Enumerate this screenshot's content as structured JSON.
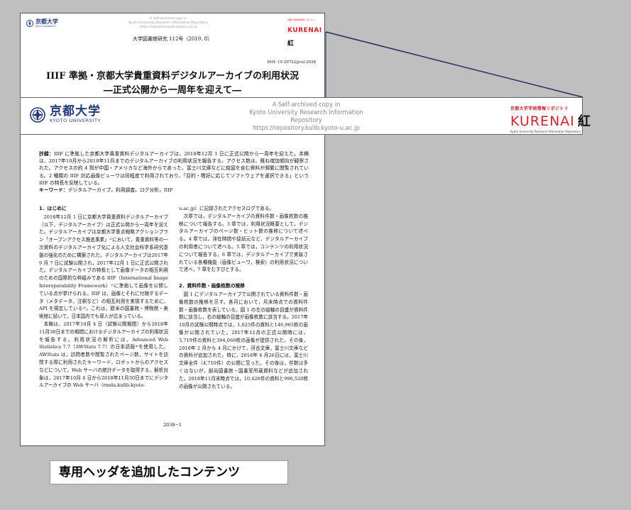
{
  "document": {
    "mini_header": {
      "logo_text": "京都大学",
      "logo_sub": "KYOTO UNIVERSITY",
      "center_lines": [
        "A Self-archived copy in",
        "Kyoto University Research Information Repository",
        "https://repository.kulib.kyoto-u.ac.jp"
      ],
      "kurenai_top": "京都大学学術情報リポジトリ",
      "kurenai_text": "KURENAI",
      "kurenai_kanji": "紅"
    },
    "journal": "大学図書館研究 112号（2019. 8）",
    "doi": "DOI: 10.20722/jcul.2038",
    "title": "IIIF 準拠・京都大学貴重資料デジタルアーカイブの利用状況",
    "subtitle": "―正式公開から一周年を迎えて―",
    "abstract_label": "抄録：",
    "abstract": "IIIF に準拠した京都大学貴重資料デジタルアーカイブは、2018年12月 1 日に正式公開から一周年を迎えた。本稿は、2017年10月から2018年11月までのデジタルアーカイブの利用状況を報告する。アクセス数は、概ね増加傾向が観察された。アクセスの約 4 割が中国・アメリカなど海外からであった。富士川文庫などに絵図を含む資料が頻繁に閲覧されている。2 種類の IIIF 対応画像ビューワは同程度で利用されており、「目的・嗜好に応じてソフトウェアを選択できる」という IIIF の特長を反映している。",
    "keywords_label": "キーワード：",
    "keywords": "デジタルアーカイブ，利用調査，ログ分析，IIIF",
    "section1_heading": "1．はじめに",
    "left_paragraphs": [
      "2018年12月 1 日に京都大学貴重資料デジタルアーカイブ（以下，デジタルアーカイブ）は正式公開から一周年を迎えた。デジタルアーカイブは京都大学重点戦略アクションプラン「オープンアクセス推進事業」¹⁾において，貴重資料等の一次資料のデジタルアーカイブ化による人文社会科学系研究基盤の強化のために構築された。デジタルアーカイブは2017年 9 月 7 日に試験公開され，2017年12月 1 日に正式公開された。デジタルアーカイブの特長として画像データの相互利用のための国際的な枠組みである IIIF（International Image Interoperability Framework）²⁾に準拠して画像を公開している点が挙げられる。IIIF は，画像とそれに付随するデータ（メタデータ，注釈など）の相互利用を実現するために，API を規定している³⁾。これは，欧米の図書館・博物館・美術館に続いて，日本国内でも導入が広まっている。",
      "本稿は，2017年10月 4 日（試験公開期間）から2018年11月30日までの期間におけるデジタルアーカイブの利用状況を報告する。利用状況の解析には，Advanced Web Statistics 7.7（AWStats 7.7）の日本語版⁴⁾を使用した。AWStats は，訪問者数や閲覧されたページ数，サイトを訪問する際に利用されたキーワード，ロボットからのアクセスなどについて，Web サーバの統計データを取得する。解析対象は，2017年10月 4 日から2018年11月30日までにデジタルアーカイブの Web サーバ（rmda.kulib.kyoto-"
    ],
    "right_paragraphs": [
      "u.ac.jp）に記録されたアクセスログである。",
      "次章では，デジタルアーカイブの資料件数・画像枚数の推移について報告する。3 章では，利用状況概要として，デジタルアーカイブのページ数・ヒット数の推移について述べる。4 章では，滞在時間や接続元など，デジタルアーカイブの利用者について述べる。5 章では，コンテンツの利用状況について報告する。6 章では，デジタルアーカイブで実装されている各種機能（画像ビューワ，検索）の利用状況について述べ，7 章をむすびとする。"
    ],
    "section2_heading": "2．資料件数・画像枚数の推移",
    "section2_paragraph": "図 1 にデジタルアーカイブで公開されている資料件数・画像枚数の推移を示す。各月において，月末時点での資料件数・画像枚数を表している。図 1 の左の縦軸の目盛が資料件数に該当し，右の縦軸の目盛が画像枚数に該当する。2017年10月の試験公開時点では，1,625件の資料と146,965枚の画像が公開されていた。2017年12月の正式公開時には，3,719件の資料と394,069枚の画像が提供された。その後，2018年 2 月から 4 月にかけて，河合文庫，富士川文庫などの資料が追加された。特に，2018年 4 月26日には，富士川文庫全件（4,710件）の公開に至った。その後は，件数は多くはないが，部局図書館・図書室所蔵資料などが追加された。2018年11月末時点では，10,426件の資料と996,520枚の画像が公開されている。",
    "page_number": "2038−1"
  },
  "header_band": {
    "logo_text": "京都大学",
    "logo_sub": "KYOTO UNIVERSITY",
    "center_lines": [
      "A Self-archived copy in",
      "Kyoto University Research Information Repository",
      "https://repository.kulib.kyoto-u.ac.jp"
    ],
    "kurenai_top": "京都大学学術情報リポジトリ",
    "kurenai_text": "KURENAI",
    "kurenai_kanji": "紅",
    "kurenai_bottom": "Kyoto University Research Information Repository"
  },
  "caption": "専用ヘッダを追加したコンテンツ",
  "colors": {
    "brand_blue": "#233a78",
    "kurenai_red": "#d2232a",
    "connector": "#1f2e5e",
    "background": "#bfbfbf"
  }
}
